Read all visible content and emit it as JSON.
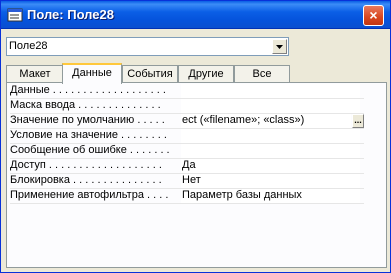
{
  "window": {
    "title": "Поле: Поле28",
    "close_label": "×"
  },
  "combo": {
    "value": "Поле28"
  },
  "tabs": [
    {
      "label": "Макет"
    },
    {
      "label": "Данные"
    },
    {
      "label": "События"
    },
    {
      "label": "Другие"
    },
    {
      "label": "Все"
    }
  ],
  "properties": [
    {
      "label": "Данные . . . . . . . . . . . . . . . . . . .",
      "value": ""
    },
    {
      "label": "Маска ввода . . . . . . . . . . . . . .",
      "value": ""
    },
    {
      "label": "Значение по умолчанию . . . . .",
      "value": "ect («filename»; «class»)"
    },
    {
      "label": "Условие на значение . . . . . . . .",
      "value": ""
    },
    {
      "label": "Сообщение об ошибке . . . . . . .",
      "value": ""
    },
    {
      "label": "Доступ . . . . . . . . . . . . . . . . . . .",
      "value": "Да"
    },
    {
      "label": "Блокировка . . . . . . . . . . . . . . .",
      "value": "Нет"
    },
    {
      "label": "Применение автофильтра . . . .",
      "value": "Параметр базы данных"
    }
  ],
  "build_button_label": "..."
}
